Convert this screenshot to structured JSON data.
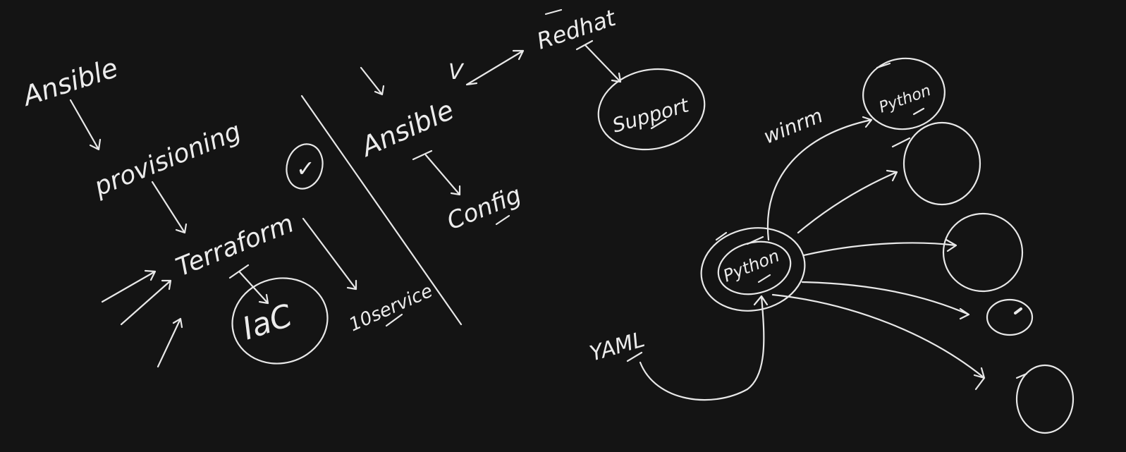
{
  "board": {
    "background": "#141414",
    "ink_color": "#e8e8e8"
  },
  "labels": {
    "ansible_left": "Ansible",
    "provisioning": "provisioning",
    "terraform": "Terraform",
    "iac": "IaC",
    "tick_circle": "✓",
    "services": "10service",
    "ansible_right": "Ansible",
    "tick_ansible": "V",
    "redhat": "Redhat",
    "support": "Support",
    "config": "Config",
    "winrm": "winrm",
    "python_remote": "Python",
    "python_center": "Python",
    "yaml": "YAML"
  }
}
